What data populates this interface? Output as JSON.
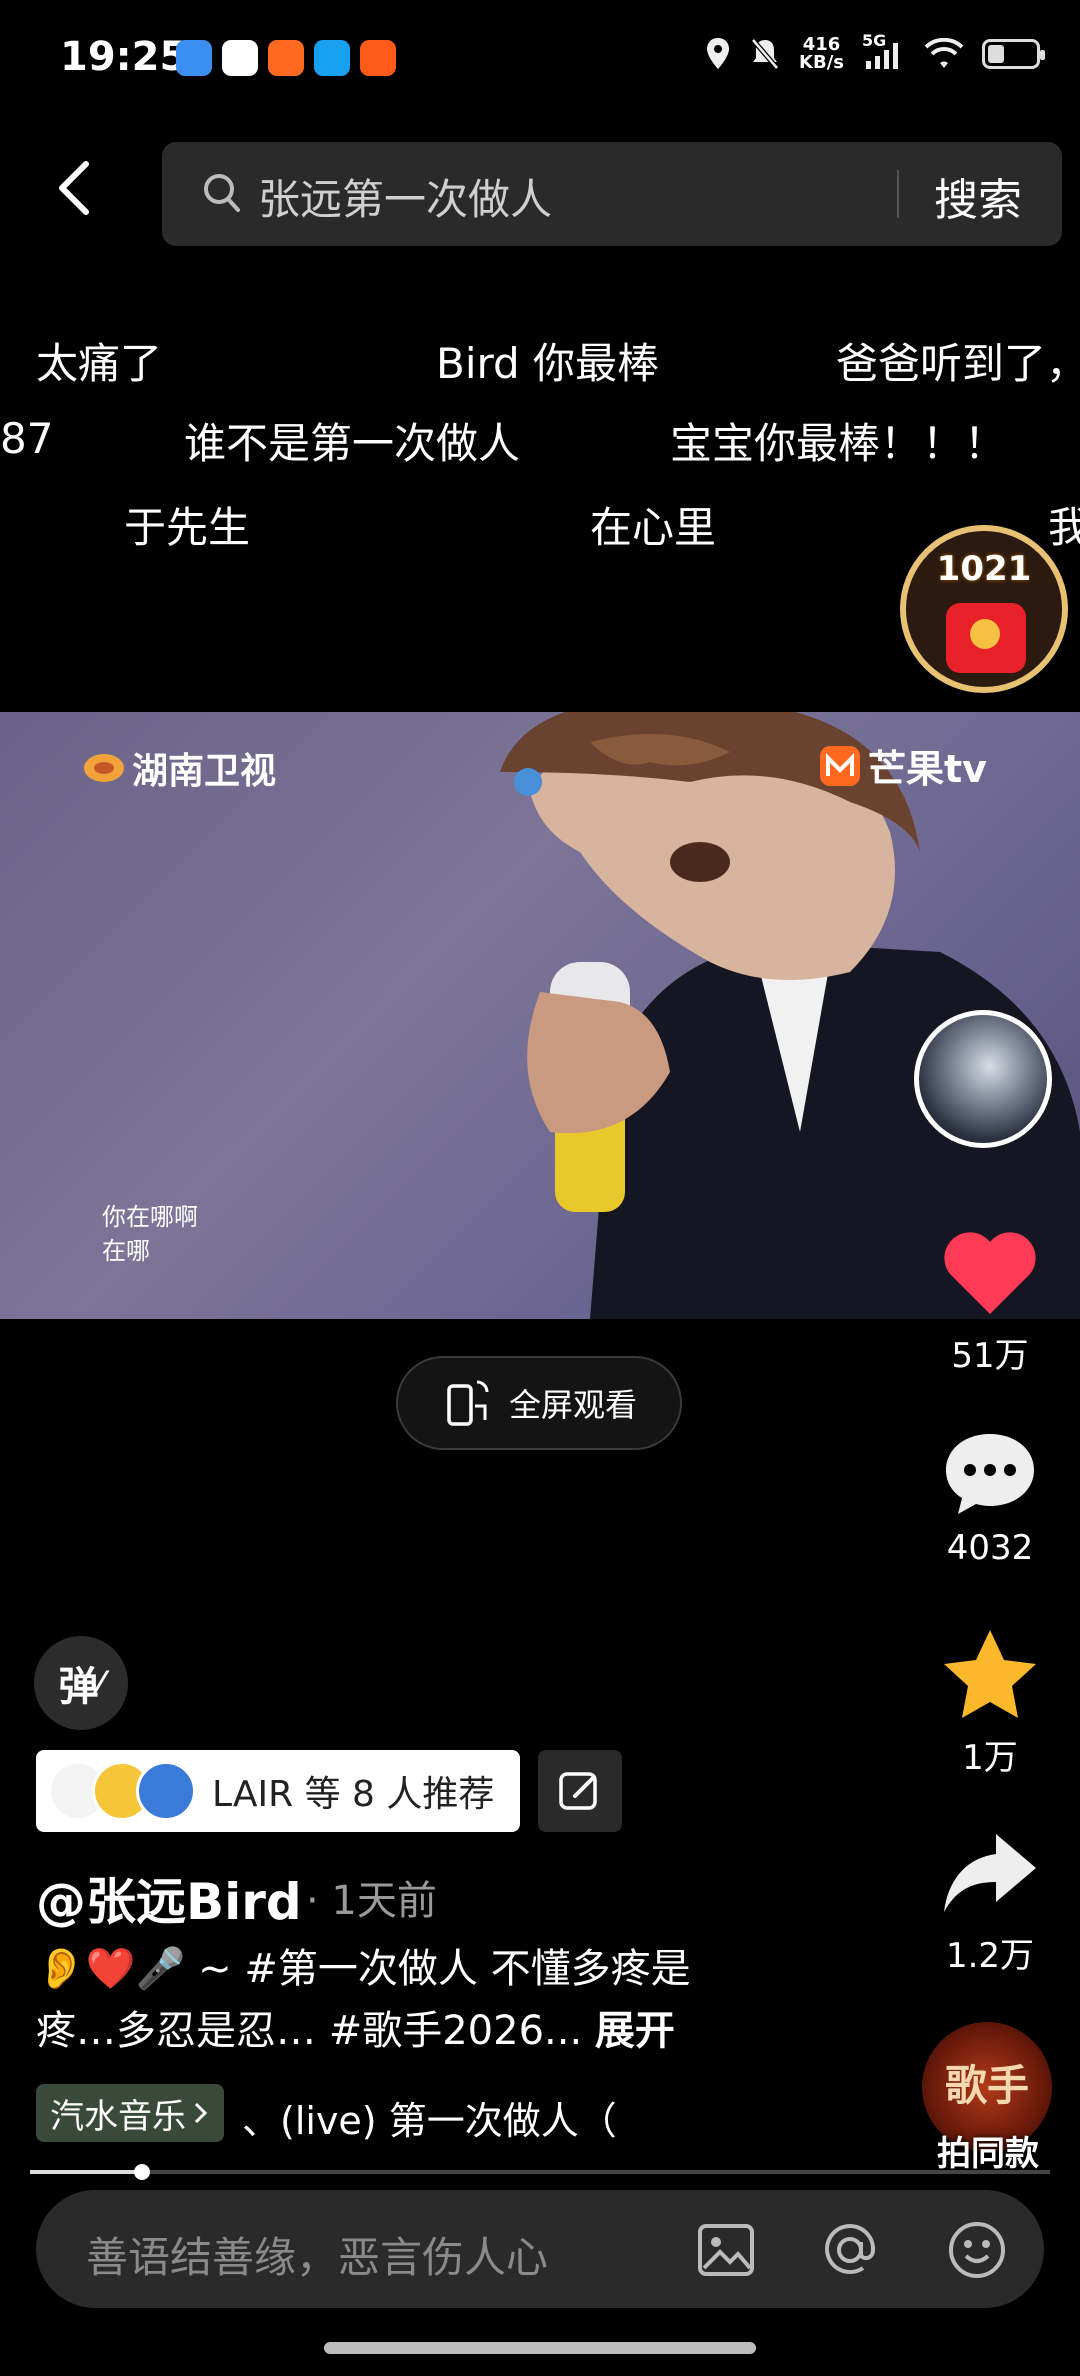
{
  "status": {
    "time": "19:25",
    "net_speed_value": "416",
    "net_speed_unit": "KB/s",
    "network": "5G",
    "battery_level": 0.35,
    "app_icons": [
      {
        "name": "app-icon-blue",
        "color": "#3a8ff0"
      },
      {
        "name": "app-icon-cloud",
        "color": "#ffffff"
      },
      {
        "name": "app-icon-mango",
        "color": "#ff6a20"
      },
      {
        "name": "app-icon-n",
        "color": "#1aa0f0"
      },
      {
        "name": "app-icon-orange",
        "color": "#ff5a1a"
      }
    ]
  },
  "search": {
    "query": "张远第一次做人",
    "button": "搜索"
  },
  "danmaku": [
    {
      "text": "太痛了"
    },
    {
      "text": "Bird 你最棒"
    },
    {
      "text": "爸爸听到了，"
    },
    {
      "text": "87"
    },
    {
      "text": "谁不是第一次做人"
    },
    {
      "text": "宝宝你最棒！！！"
    },
    {
      "text": "于先生"
    },
    {
      "text": "在心里"
    },
    {
      "text": "我"
    }
  ],
  "red_packet": {
    "count": "1021"
  },
  "video": {
    "logo_left": "湖南卫视",
    "logo_right": "芒果tv",
    "subtitle_line1": "你在哪啊",
    "subtitle_line2": "在哪"
  },
  "actions": {
    "likes": "51万",
    "comments": "4032",
    "favorites": "1万",
    "shares": "1.2万"
  },
  "fullscreen_label": "全屏观看",
  "danmaku_toggle": "弹",
  "recommend": {
    "text": "LAIR 等 8 人推荐"
  },
  "post": {
    "author": "@张远Bird",
    "time_ago": "· 1天前",
    "emoji": "👂❤️🎤",
    "desc_line1": " ~ #第一次做人 不懂多疼是",
    "desc_line2": "疼…多忍是忍… #歌手2026...",
    "expand": "展开"
  },
  "music": {
    "tag": "汽水音乐",
    "text": "、(live)    第一次做人（"
  },
  "shoot_same": {
    "disc_text": "歌手",
    "label": "拍同款"
  },
  "progress": 0.11,
  "comment": {
    "placeholder": "善语结善缘，恶言伤人心"
  }
}
